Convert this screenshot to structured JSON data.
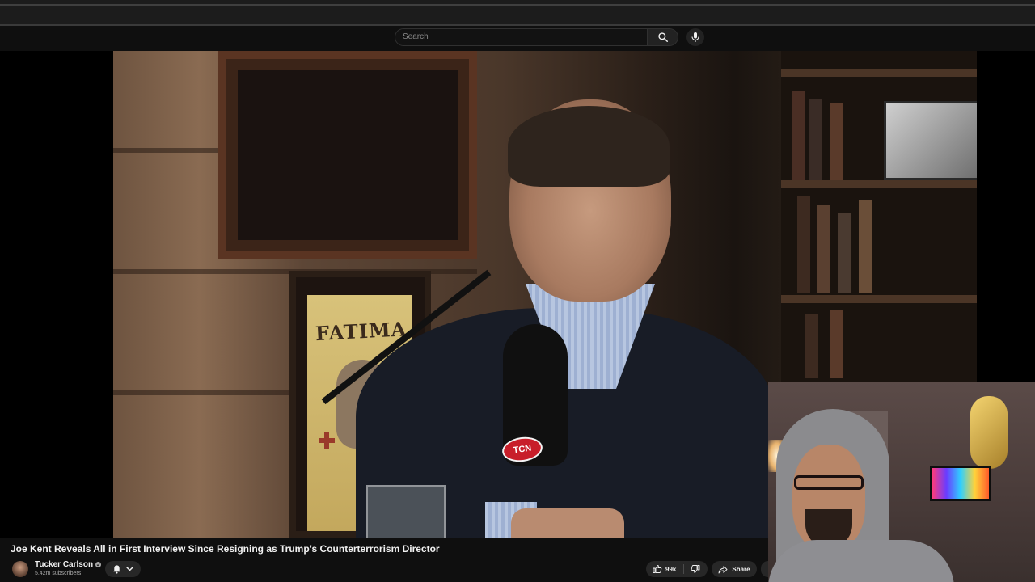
{
  "search": {
    "placeholder": "Search"
  },
  "video": {
    "title": "Joe Kent Reveals All in First Interview Since Resigning as Trump’s Counterterrorism Director",
    "poster_text": "FATIMA",
    "mic_badge": "TCN"
  },
  "channel": {
    "name": "Tucker Carlson",
    "verified": true,
    "subscribers": "5.42m subscribers"
  },
  "actions": {
    "likes": "99k",
    "share_label": "Share"
  },
  "icons": {
    "search": "search-icon",
    "mic": "microphone-icon",
    "bell": "bell-icon",
    "chevron": "chevron-down-icon",
    "like": "thumbs-up-icon",
    "dislike": "thumbs-down-icon",
    "share": "share-icon",
    "verified": "verified-check-icon"
  },
  "colors": {
    "background": "#0f0f0f",
    "pill": "#272727",
    "text": "#f1f1f1",
    "muted": "#aaaaaa",
    "badge_red": "#c81e2a"
  }
}
